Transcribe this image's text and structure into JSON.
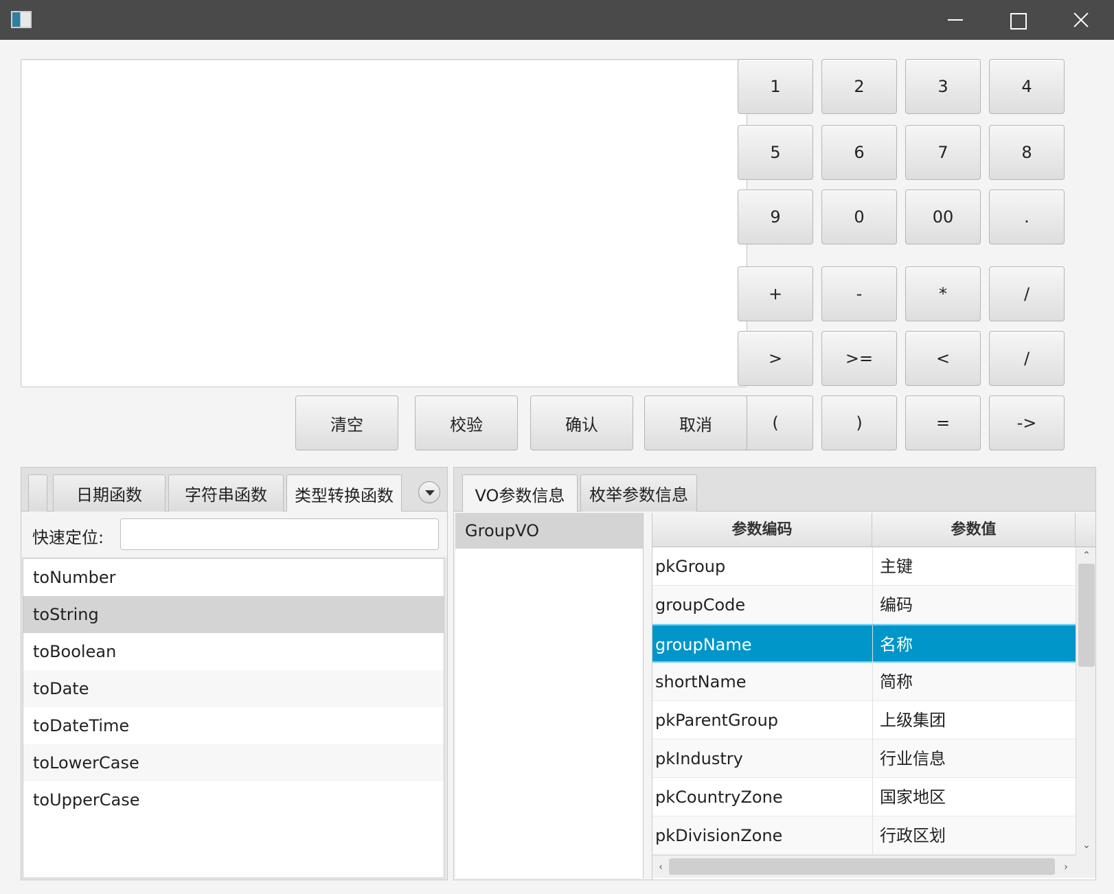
{
  "keypad": {
    "keys": [
      "1",
      "2",
      "3",
      "4",
      "5",
      "6",
      "7",
      "8",
      "9",
      "0",
      "00",
      ".",
      "+",
      "-",
      "*",
      "/",
      ">",
      ">=",
      "<",
      "/",
      "(",
      ")",
      "=",
      "->"
    ]
  },
  "actions": {
    "clear": "清空",
    "validate": "校验",
    "confirm": "确认",
    "cancel": "取消"
  },
  "left_panel": {
    "tabs": [
      "日期函数",
      "字符串函数",
      "类型转换函数"
    ],
    "active_tab": "类型转换函数",
    "search_label": "快速定位:",
    "search_value": "",
    "functions": [
      "toNumber",
      "toString",
      "toBoolean",
      "toDate",
      "toDateTime",
      "toLowerCase",
      "toUpperCase"
    ],
    "selected_function": "toString"
  },
  "right_panel": {
    "tabs": [
      "VO参数信息",
      "枚举参数信息"
    ],
    "active_tab": "VO参数信息",
    "vo_list": [
      "GroupVO"
    ],
    "table": {
      "headers": [
        "参数编码",
        "参数值"
      ],
      "rows": [
        [
          "pkGroup",
          "主键"
        ],
        [
          "groupCode",
          "编码"
        ],
        [
          "groupName",
          "名称"
        ],
        [
          "shortName",
          "简称"
        ],
        [
          "pkParentGroup",
          "上级集团"
        ],
        [
          "pkIndustry",
          "行业信息"
        ],
        [
          "pkCountryZone",
          "国家地区"
        ],
        [
          "pkDivisionZone",
          "行政区划"
        ]
      ],
      "selected_row": "groupName"
    }
  },
  "colors": {
    "titlebar": "#4a4a4a",
    "selection": "#0096c9"
  },
  "icons": {
    "app": "app-icon",
    "minimize": "minimize-icon",
    "maximize": "maximize-icon",
    "close": "close-icon",
    "tab_menu": "chevron-down-icon"
  }
}
